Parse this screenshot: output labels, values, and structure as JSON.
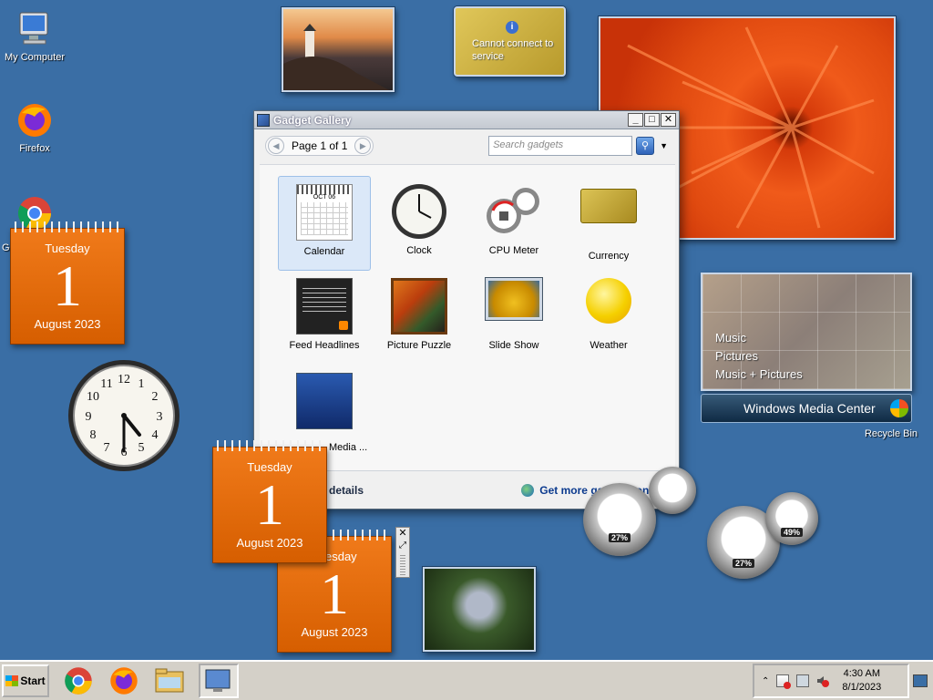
{
  "desktop": {
    "icons": [
      {
        "label": "My Computer"
      },
      {
        "label": "Firefox"
      },
      {
        "label": "Go"
      },
      {
        "label": "Recycle Bin"
      }
    ]
  },
  "currency_gadget": {
    "message": "Cannot connect to service"
  },
  "calendars": [
    {
      "day": "Tuesday",
      "date": "1",
      "month": "August 2023"
    },
    {
      "day": "Tuesday",
      "date": "1",
      "month": "August 2023"
    },
    {
      "day": "Tuesday",
      "date": "1",
      "month": "August 2023"
    }
  ],
  "analog_clock": {
    "numbers": [
      "12",
      "1",
      "2",
      "3",
      "4",
      "5",
      "6",
      "7",
      "8",
      "9",
      "10",
      "11"
    ]
  },
  "gallery": {
    "title": "Gadget Gallery",
    "page": "Page 1 of 1",
    "search_placeholder": "Search gadgets",
    "gadgets": [
      {
        "name": "Calendar",
        "icon": "calendar-icon"
      },
      {
        "name": "Clock",
        "icon": "clock-icon"
      },
      {
        "name": "CPU Meter",
        "icon": "cpu-meter-icon"
      },
      {
        "name": "Currency",
        "icon": "currency-icon"
      },
      {
        "name": "Feed Headlines",
        "icon": "feed-icon"
      },
      {
        "name": "Picture Puzzle",
        "icon": "puzzle-icon"
      },
      {
        "name": "Slide Show",
        "icon": "slideshow-icon"
      },
      {
        "name": "Weather",
        "icon": "weather-icon"
      },
      {
        "name": "Media ...",
        "icon": "media-center-icon"
      }
    ],
    "mini_calendar": {
      "month": "OCT 06"
    },
    "details_label": "details",
    "more_link": "Get more gadgets online"
  },
  "media_center": {
    "menu": [
      "Music",
      "Pictures",
      "Music + Pictures"
    ],
    "bar_label": "Windows Media Center"
  },
  "cpu_meters": [
    {
      "value": "27%"
    },
    {
      "value": "27%"
    },
    {
      "value": "49%"
    }
  ],
  "taskbar": {
    "start_label": "Start",
    "time": "4:30 AM",
    "date": "8/1/2023"
  }
}
